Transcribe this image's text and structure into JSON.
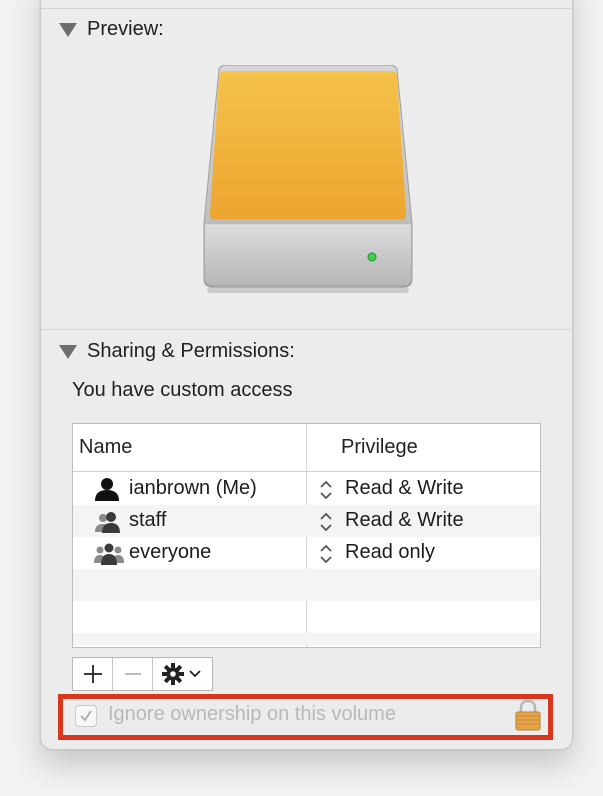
{
  "preview": {
    "title": "Preview:"
  },
  "sharing": {
    "title": "Sharing & Permissions:",
    "access_text": "You have custom access",
    "columns": {
      "name": "Name",
      "privilege": "Privilege"
    },
    "rows": [
      {
        "name": "ianbrown (Me)",
        "privilege": "Read & Write",
        "icon": "person-icon"
      },
      {
        "name": "staff",
        "privilege": "Read & Write",
        "icon": "group-icon"
      },
      {
        "name": "everyone",
        "privilege": "Read only",
        "icon": "everyone-icon"
      }
    ]
  },
  "toolbar": {
    "add": "+",
    "remove": "−",
    "action": "gear-icon"
  },
  "ownership": {
    "label": "Ignore ownership on this volume",
    "checked": true,
    "disabled": true
  },
  "colors": {
    "highlight": "#d9361e",
    "drive_face": "#f0b43c",
    "led": "#3bd14a"
  }
}
